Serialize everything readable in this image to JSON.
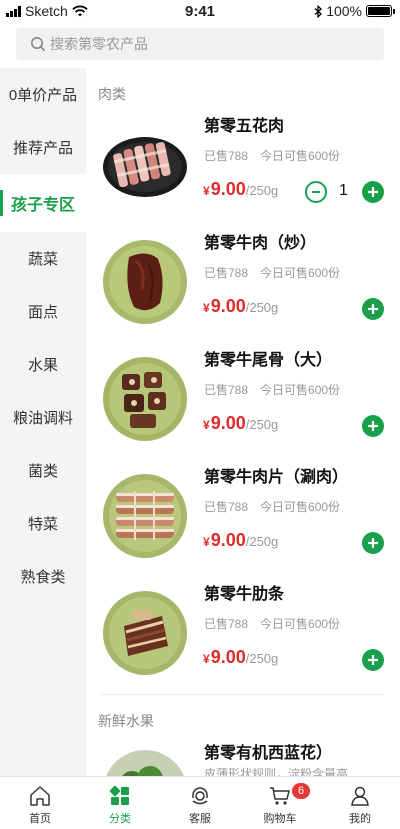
{
  "status_bar": {
    "carrier": "Sketch",
    "time": "9:41",
    "battery": "100%"
  },
  "search": {
    "placeholder": "搜索第零农产品"
  },
  "sidebar": {
    "items": [
      {
        "label": "0单价产品"
      },
      {
        "label": "推荐产品"
      },
      {
        "label": "孩子专区",
        "active": true
      },
      {
        "label": "蔬菜"
      },
      {
        "label": "面点"
      },
      {
        "label": "水果"
      },
      {
        "label": "粮油调料"
      },
      {
        "label": "菌类"
      },
      {
        "label": "特菜"
      },
      {
        "label": "熟食类"
      }
    ]
  },
  "sections": [
    {
      "title": "肉类",
      "products": [
        {
          "name": "第零五花肉",
          "sold": "已售788",
          "available": "今日可售600份",
          "currency": "¥",
          "price": "9.00",
          "unit": "/250g",
          "quantity": "1"
        },
        {
          "name": "第零牛肉（炒）",
          "sold": "已售788",
          "available": "今日可售600份",
          "currency": "¥",
          "price": "9.00",
          "unit": "/250g"
        },
        {
          "name": "第零牛尾骨（大）",
          "sold": "已售788",
          "available": "今日可售600份",
          "currency": "¥",
          "price": "9.00",
          "unit": "/250g"
        },
        {
          "name": "第零牛肉片（涮肉）",
          "sold": "已售788",
          "available": "今日可售600份",
          "currency": "¥",
          "price": "9.00",
          "unit": "/250g"
        },
        {
          "name": "第零牛肋条",
          "sold": "已售788",
          "available": "今日可售600份",
          "currency": "¥",
          "price": "9.00",
          "unit": "/250g"
        }
      ]
    },
    {
      "title": "新鲜水果",
      "products": [
        {
          "name": "第零有机西蓝花）",
          "description": "皮薄形状规则，淀粉含量高"
        }
      ]
    }
  ],
  "tabbar": {
    "items": [
      {
        "label": "首页",
        "icon": "home-icon"
      },
      {
        "label": "分类",
        "icon": "category-icon",
        "active": true
      },
      {
        "label": "客服",
        "icon": "service-icon"
      },
      {
        "label": "购物车",
        "icon": "cart-icon",
        "badge": "6"
      },
      {
        "label": "我的",
        "icon": "profile-icon"
      }
    ]
  },
  "colors": {
    "accent": "#1aa04a",
    "price": "#e02b2b",
    "badge": "#e53935"
  }
}
